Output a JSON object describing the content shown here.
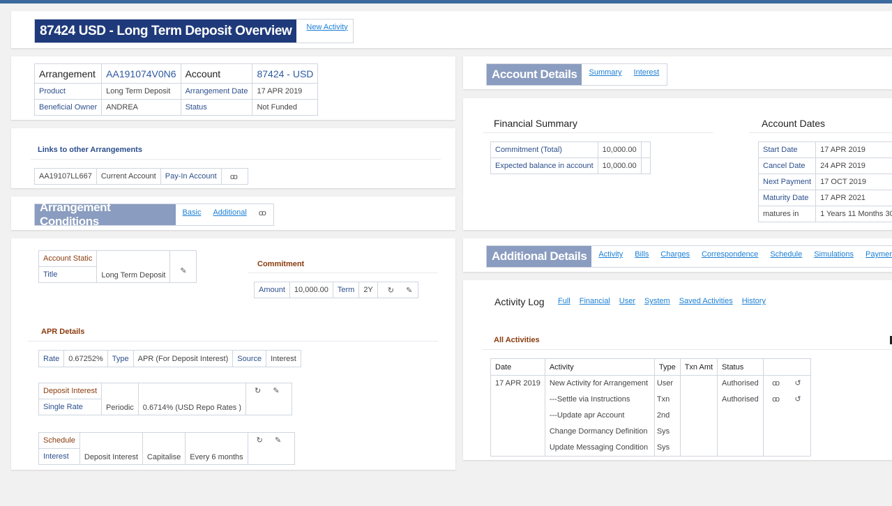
{
  "header": {
    "title": "87424 USD - Long Term Deposit Overview",
    "new_activity": "New Activity"
  },
  "arrangement": {
    "arr_label": "Arrangement",
    "arr_value": "AA191074V0N6",
    "acct_label": "Account",
    "acct_value": "87424 - USD",
    "product_label": "Product",
    "product_value": "Long Term Deposit",
    "arr_date_label": "Arrangement Date",
    "arr_date_value": "17 APR 2019",
    "owner_label": "Beneficial Owner",
    "owner_value": "ANDREA",
    "status_label": "Status",
    "status_value": "Not Funded"
  },
  "links": {
    "title": "Links to other Arrangements",
    "id": "AA19107LL667",
    "type": "Current Account",
    "role": "Pay-In Account"
  },
  "conditions": {
    "title": "Arrangement Conditions",
    "tab_basic": "Basic",
    "tab_additional": "Additional",
    "static_label": "Account Static",
    "title_label": "Title",
    "title_value": "Long Term Deposit",
    "commitment_title": "Commitment",
    "amount_label": "Amount",
    "amount_value": "10,000.00",
    "term_label": "Term",
    "term_value": "2Y",
    "apr_title": "APR Details",
    "rate_label": "Rate",
    "rate_value": "0.67252%",
    "type_label": "Type",
    "type_value": "APR (For Deposit Interest)",
    "source_label": "Source",
    "source_value": "Interest",
    "deposit_label": "Deposit Interest",
    "single_label": "Single Rate",
    "periodic": "Periodic",
    "single_value": "0.6714% (USD Repo Rates )",
    "schedule_label": "Schedule",
    "interest_label": "Interest",
    "sched_interest": "Deposit Interest",
    "sched_capitalise": "Capitalise",
    "sched_freq": "Every 6 months"
  },
  "account_details": {
    "title": "Account Details",
    "tab_summary": "Summary",
    "tab_interest": "Interest"
  },
  "financial": {
    "title": "Financial Summary",
    "commit_label": "Commitment (Total)",
    "commit_value": "10,000.00",
    "expected_label": "Expected balance in account",
    "expected_value": "10,000.00"
  },
  "dates": {
    "title": "Account Dates",
    "start_label": "Start Date",
    "start_value": "17 APR 2019",
    "cancel_label": "Cancel Date",
    "cancel_value": "24 APR 2019",
    "next_label": "Next Payment",
    "next_value": "17 OCT 2019",
    "maturity_label": "Maturity Date",
    "maturity_value": "17 APR 2021",
    "matures_label": "matures in",
    "matures_value": "1 Years 11 Months 30"
  },
  "additional": {
    "title": "Additional Details",
    "tabs": [
      "Activity",
      "Bills",
      "Charges",
      "Correspondence",
      "Schedule",
      "Simulations",
      "Paymen"
    ]
  },
  "activity_log": {
    "title": "Activity Log",
    "filters": [
      "Full",
      "Financial",
      "User",
      "System",
      "Saved Activities",
      "History"
    ],
    "section": "All Activities",
    "headers": {
      "date": "Date",
      "activity": "Activity",
      "type": "Type",
      "txn": "Txn Amt",
      "status": "Status"
    },
    "date": "17 APR 2019",
    "rows": [
      {
        "activity": "New Activity for Arrangement",
        "type": "User",
        "status": "Authorised"
      },
      {
        "activity": "---Settle via Instructions",
        "type": "Txn",
        "status": "Authorised"
      },
      {
        "activity": "---Update apr Account",
        "type": "2nd",
        "status": ""
      },
      {
        "activity": "Change Dormancy Definition",
        "type": "Sys",
        "status": ""
      },
      {
        "activity": "Update Messaging Condition",
        "type": "Sys",
        "status": ""
      }
    ]
  },
  "colors": {
    "title_dark": "#1f3a7a",
    "title_slate": "#8a9cbf",
    "accent_bar": "#3a6a9e"
  }
}
